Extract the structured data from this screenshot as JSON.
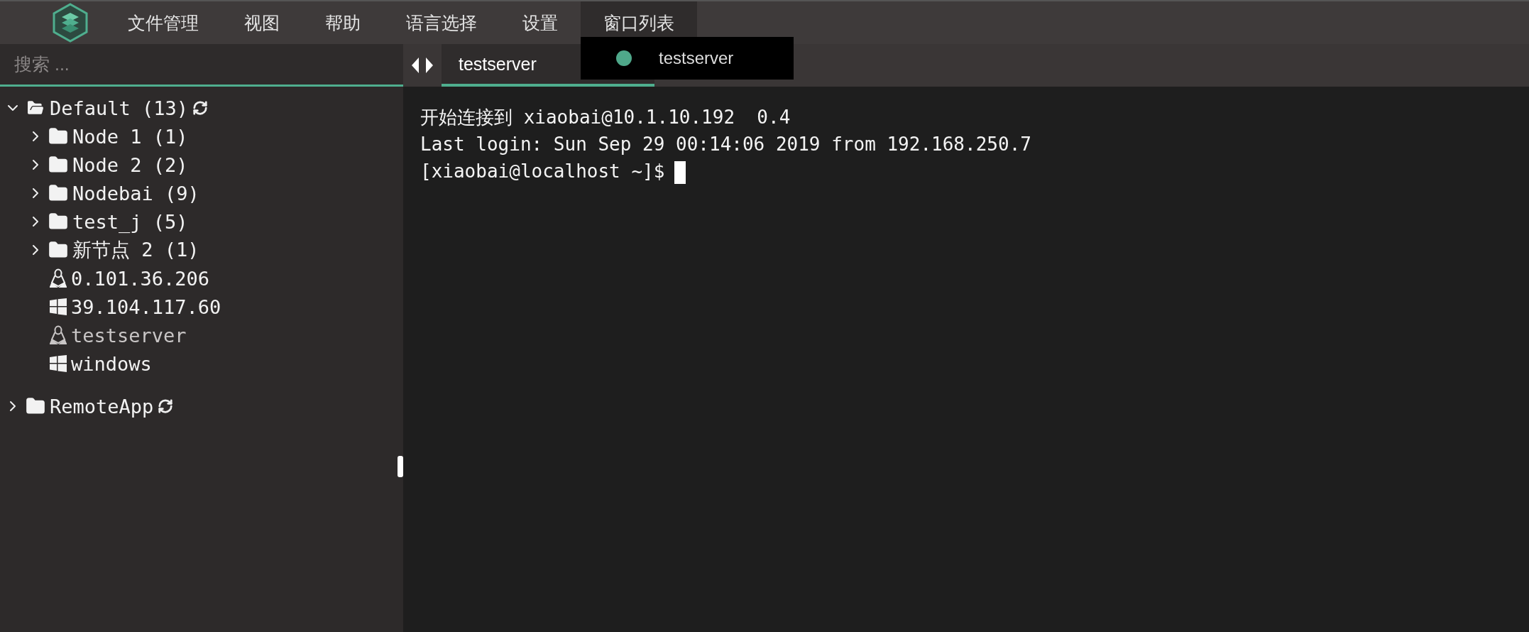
{
  "menu_bar": {
    "items": [
      {
        "label": "文件管理",
        "selected": false
      },
      {
        "label": "视图",
        "selected": false
      },
      {
        "label": "帮助",
        "selected": false
      },
      {
        "label": "语言选择",
        "selected": false
      },
      {
        "label": "设置",
        "selected": false
      },
      {
        "label": "窗口列表",
        "selected": true
      }
    ]
  },
  "window_list_menu": {
    "items": [
      {
        "label": "testserver",
        "color": "#4fa88a"
      }
    ]
  },
  "sidebar": {
    "search": {
      "placeholder": "搜索 ..."
    },
    "tree": [
      {
        "label": "Default (13)",
        "kind": "folder",
        "expanded": true,
        "refresh": true,
        "selected": false,
        "children": [
          {
            "label": "Node 1 (1)",
            "kind": "folder",
            "expanded": false,
            "selected": false
          },
          {
            "label": "Node 2 (2)",
            "kind": "folder",
            "expanded": false,
            "selected": false
          },
          {
            "label": "Nodebai (9)",
            "kind": "folder",
            "expanded": false,
            "selected": false
          },
          {
            "label": "test_j (5)",
            "kind": "folder",
            "expanded": false,
            "selected": false
          },
          {
            "label": "新节点 2 (1)",
            "kind": "folder",
            "expanded": false,
            "selected": false
          },
          {
            "label": "0.101.36.206",
            "kind": "linux",
            "selected": false
          },
          {
            "label": "39.104.117.60",
            "kind": "windows",
            "selected": false
          },
          {
            "label": "testserver",
            "kind": "linux",
            "selected": true
          },
          {
            "label": "windows",
            "kind": "windows",
            "selected": false
          }
        ]
      },
      {
        "label": "RemoteApp",
        "kind": "folder",
        "expanded": false,
        "refresh": true,
        "selected": false
      }
    ]
  },
  "terminal": {
    "tabs": [
      {
        "label": "testserver",
        "selected": true
      }
    ],
    "lines": [
      "开始连接到 xiaobai@10.1.10.192  0.4",
      "Last login: Sun Sep 29 00:14:06 2019 from 192.168.250.7"
    ],
    "prompt": "[xiaobai@localhost ~]$"
  }
}
